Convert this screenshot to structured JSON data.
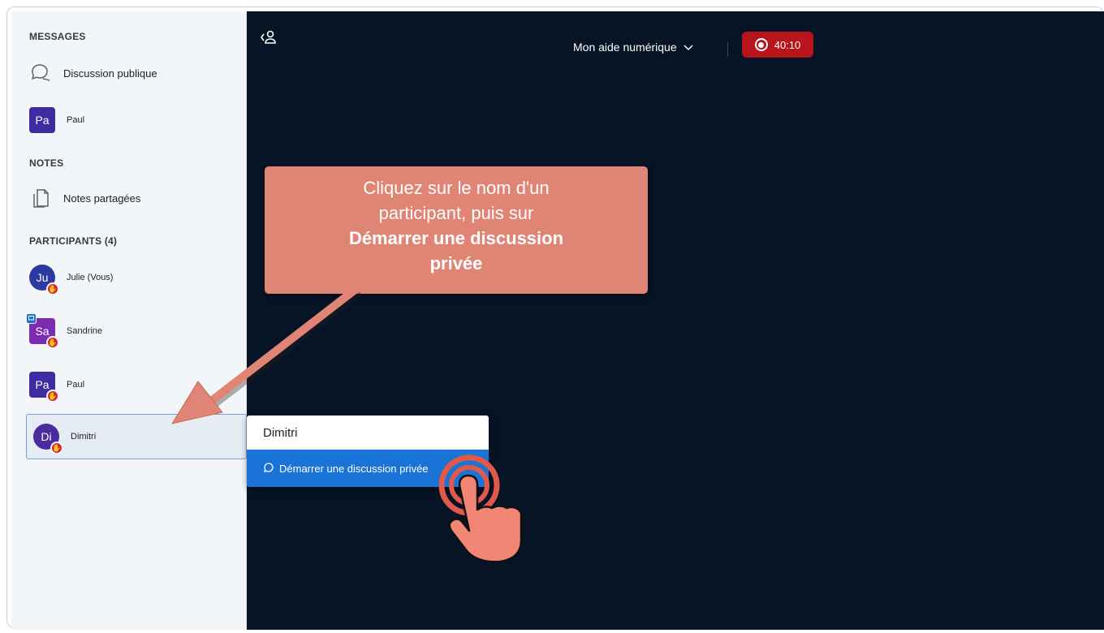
{
  "sidebar": {
    "messages_title": "MESSAGES",
    "public_chat": "Discussion publique",
    "dm_user": {
      "initials": "Pa",
      "name": "Paul"
    },
    "notes_title": "NOTES",
    "shared_notes": "Notes partagées",
    "participants_title": "PARTICIPANTS (4)",
    "participants": [
      {
        "initials": "Ju",
        "name": "Julie (Vous)",
        "color": "#2a3a9e"
      },
      {
        "initials": "Sa",
        "name": "Sandrine",
        "color": "#7b2bb0"
      },
      {
        "initials": "Pa",
        "name": "Paul",
        "color": "#3f2ca0"
      },
      {
        "initials": "Di",
        "name": "Dimitri",
        "color": "#4b2c9e"
      }
    ]
  },
  "header": {
    "room_name": "Mon aide numérique",
    "timer": "40:10"
  },
  "context_menu": {
    "name": "Dimitri",
    "action": "Démarrer une discussion privée"
  },
  "callout": {
    "line1": "Cliquez sur le nom d'un",
    "line2": "participant, puis sur",
    "line3": "Démarrer une discussion",
    "line4": "privée"
  },
  "colors": {
    "accent": "#1a73d6",
    "record": "#b8141c",
    "callout": "#e08575",
    "main_bg": "#061426"
  }
}
